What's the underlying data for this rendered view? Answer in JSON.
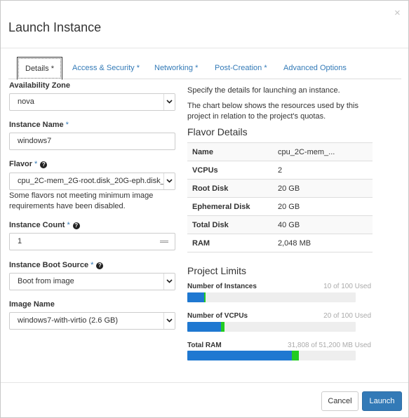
{
  "modal": {
    "title": "Launch Instance",
    "close_glyph": "×"
  },
  "tabs": [
    {
      "label": "Details",
      "required": "*",
      "active": true
    },
    {
      "label": "Access & Security",
      "required": "*"
    },
    {
      "label": "Networking",
      "required": "*"
    },
    {
      "label": "Post-Creation",
      "required": "*"
    },
    {
      "label": "Advanced Options",
      "required": ""
    }
  ],
  "form": {
    "availability_zone": {
      "label": "Availability Zone",
      "value": "nova"
    },
    "instance_name": {
      "label": "Instance Name",
      "required": "*",
      "value": "windows7"
    },
    "flavor": {
      "label": "Flavor",
      "required": "*",
      "value": "cpu_2C-mem_2G-root.disk_20G-eph.disk_",
      "note": "Some flavors not meeting minimum image requirements have been disabled."
    },
    "instance_count": {
      "label": "Instance Count",
      "required": "*",
      "value": "1"
    },
    "boot_source": {
      "label": "Instance Boot Source",
      "required": "*",
      "value": "Boot from image"
    },
    "image_name": {
      "label": "Image Name",
      "value": "windows7-with-virtio (2.6 GB)"
    },
    "help_glyph": "?"
  },
  "info": {
    "specify": "Specify the details for launching an instance.",
    "chart_note": "The chart below shows the resources used by this project in relation to the project's quotas."
  },
  "flavor_details": {
    "title": "Flavor Details",
    "rows": [
      {
        "key": "Name",
        "value": "cpu_2C-mem_..."
      },
      {
        "key": "VCPUs",
        "value": "2"
      },
      {
        "key": "Root Disk",
        "value": "20 GB"
      },
      {
        "key": "Ephemeral Disk",
        "value": "20 GB"
      },
      {
        "key": "Total Disk",
        "value": "40 GB"
      },
      {
        "key": "RAM",
        "value": "2,048 MB"
      }
    ]
  },
  "project_limits": {
    "title": "Project Limits",
    "items": [
      {
        "label": "Number of Instances",
        "used_text": "10 of 100 Used",
        "used_fraction": 0.1,
        "added_fraction": 0.01
      },
      {
        "label": "Number of VCPUs",
        "used_text": "20 of 100 Used",
        "used_fraction": 0.2,
        "added_fraction": 0.02
      },
      {
        "label": "Total RAM",
        "used_text": "31,808 of 51,200 MB Used",
        "used_fraction": 0.621,
        "added_fraction": 0.04
      }
    ],
    "colors": {
      "used": "#1f78d1",
      "added": "#22cc22",
      "track": "#eeeeee"
    }
  },
  "footer": {
    "cancel_label": "Cancel",
    "launch_label": "Launch"
  },
  "colors": {
    "link": "#337ab7",
    "primary_button": "#337ab7"
  }
}
